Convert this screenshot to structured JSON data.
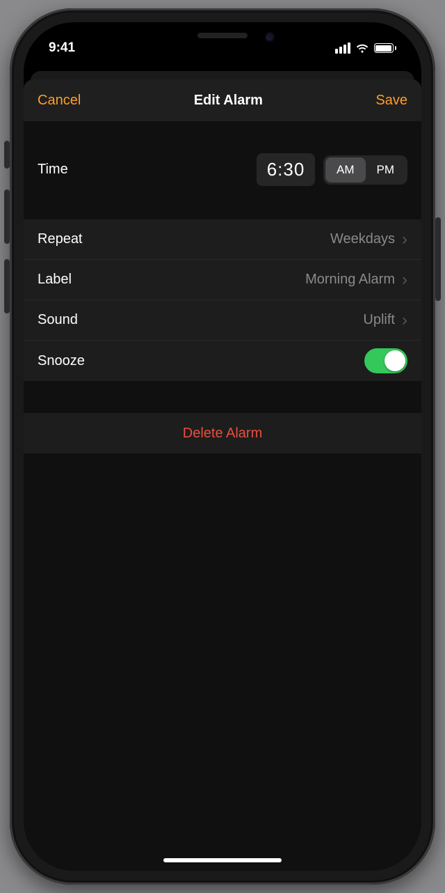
{
  "status": {
    "time": "9:41"
  },
  "nav": {
    "cancel": "Cancel",
    "title": "Edit Alarm",
    "save": "Save"
  },
  "time": {
    "label": "Time",
    "value": "6:30",
    "am": "AM",
    "pm": "PM",
    "selected": "AM"
  },
  "rows": {
    "repeat": {
      "label": "Repeat",
      "value": "Weekdays"
    },
    "label": {
      "label": "Label",
      "value": "Morning Alarm"
    },
    "sound": {
      "label": "Sound",
      "value": "Uplift"
    },
    "snooze": {
      "label": "Snooze",
      "on": true
    }
  },
  "delete": "Delete Alarm",
  "colors": {
    "accent": "#fd9e2b",
    "destructive": "#eb4f3c",
    "toggleOn": "#34c759"
  }
}
